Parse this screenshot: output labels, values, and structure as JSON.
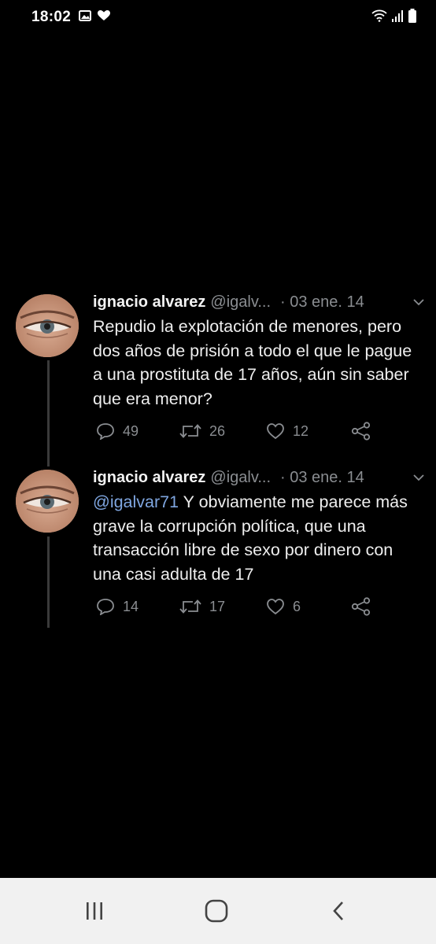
{
  "status_bar": {
    "time": "18:02",
    "icons": [
      "image-icon",
      "heart-icon",
      "wifi-icon",
      "signal-icon",
      "battery-icon"
    ]
  },
  "tweets": [
    {
      "name": "ignacio alvarez",
      "handle": "@igalv...",
      "date": "· 03 ene. 14",
      "text": "Repudio la explotación de menores, pero dos años de prisión a todo el que le pague a una prostituta de 17 años, aún sin saber que era menor?",
      "mention": "",
      "replies": "49",
      "retweets": "26",
      "likes": "12"
    },
    {
      "name": "ignacio alvarez",
      "handle": "@igalv...",
      "date": "· 03 ene. 14",
      "mention": "@igalvar71",
      "text": " Y obviamente me parece más grave la corrupción política, que una transacción libre de sexo por dinero con una casi adulta de 17",
      "replies": "14",
      "retweets": "17",
      "likes": "6"
    }
  ],
  "colors": {
    "background": "#000000",
    "text": "#eeeeee",
    "muted": "#8a8d91",
    "mention": "#7fa6e0",
    "navbar": "#f1f1f1"
  },
  "nav_bar": {
    "icons": [
      "recent-apps-icon",
      "home-icon",
      "back-icon"
    ]
  }
}
